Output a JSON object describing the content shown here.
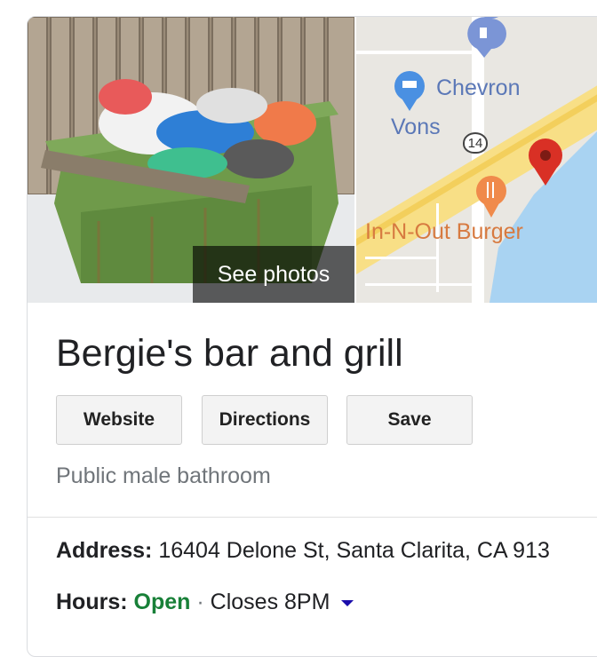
{
  "photo": {
    "see_photos_label": "See photos"
  },
  "map": {
    "labels": {
      "chevron": "Chevron",
      "vons": "Vons",
      "innout": "In-N-Out Burger"
    },
    "highway_number": "14",
    "colors": {
      "water": "#a9d3f2",
      "road": "#f8df86",
      "land": "#e9e7e2",
      "pin": "#d93025",
      "gas_pin": "#7b95d6",
      "shop_pin": "#4a90e2",
      "food_pin": "#f08a4b"
    }
  },
  "place": {
    "name": "Bergie's bar and grill",
    "category": "Public male bathroom",
    "buttons": {
      "website": "Website",
      "directions": "Directions",
      "save": "Save"
    },
    "address_label": "Address:",
    "address_value": "16404 Delone St, Santa Clarita, CA 913",
    "hours_label": "Hours:",
    "hours_status": "Open",
    "hours_separator": "·",
    "hours_closes": "Closes 8PM"
  }
}
